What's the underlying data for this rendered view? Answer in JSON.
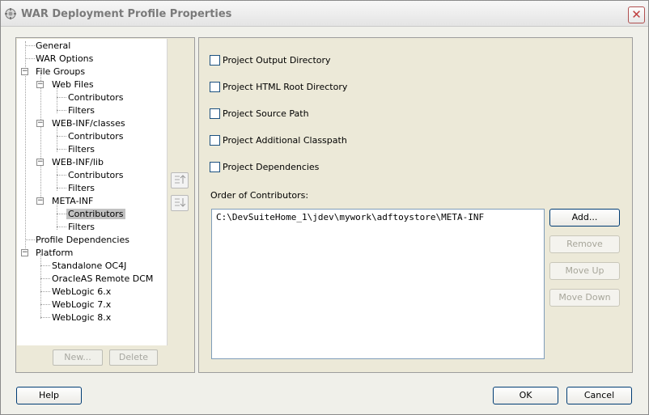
{
  "window": {
    "title": "WAR Deployment Profile Properties",
    "close_glyph": "✕"
  },
  "tree": {
    "items": [
      {
        "label": "General"
      },
      {
        "label": "WAR Options"
      },
      {
        "label": "File Groups"
      },
      {
        "label": "Web Files"
      },
      {
        "label": "Contributors"
      },
      {
        "label": "Filters"
      },
      {
        "label": "WEB-INF/classes"
      },
      {
        "label": "Contributors"
      },
      {
        "label": "Filters"
      },
      {
        "label": "WEB-INF/lib"
      },
      {
        "label": "Contributors"
      },
      {
        "label": "Filters"
      },
      {
        "label": "META-INF"
      },
      {
        "label": "Contributors"
      },
      {
        "label": "Filters"
      },
      {
        "label": "Profile Dependencies"
      },
      {
        "label": "Platform"
      },
      {
        "label": "Standalone OC4J"
      },
      {
        "label": "OracleAS Remote DCM"
      },
      {
        "label": "WebLogic 6.x"
      },
      {
        "label": "WebLogic 7.x"
      },
      {
        "label": "WebLogic 8.x"
      }
    ],
    "selected": "Contributors (META-INF)"
  },
  "left_buttons": {
    "new": "New...",
    "delete": "Delete"
  },
  "options": [
    {
      "label": "Project Output Directory",
      "checked": false
    },
    {
      "label": "Project HTML Root Directory",
      "checked": false
    },
    {
      "label": "Project Source Path",
      "checked": false
    },
    {
      "label": "Project Additional Classpath",
      "checked": false
    },
    {
      "label": "Project Dependencies",
      "checked": false
    }
  ],
  "order": {
    "label": "Order of Contributors:",
    "items": [
      "C:\\DevSuiteHome_1\\jdev\\mywork\\adftoystore\\META-INF"
    ]
  },
  "list_buttons": {
    "add": "Add...",
    "remove": "Remove",
    "move_up": "Move Up",
    "move_down": "Move Down"
  },
  "footer": {
    "help": "Help",
    "ok": "OK",
    "cancel": "Cancel"
  },
  "colors": {
    "selection": "#c1c1c1",
    "checkbox_border": "#1c5180",
    "button_border": "#003c74"
  }
}
